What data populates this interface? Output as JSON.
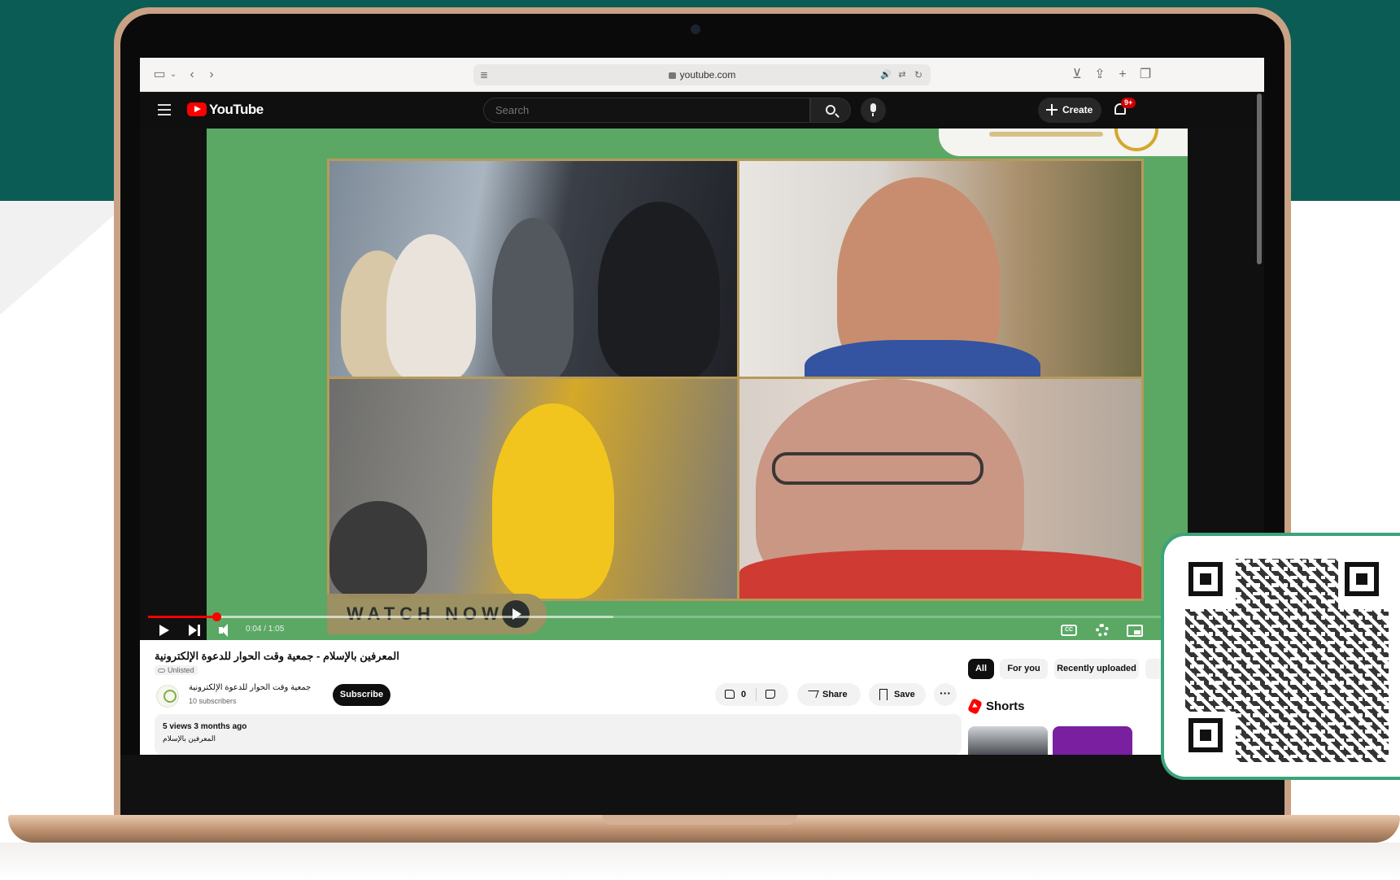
{
  "browser": {
    "url": "youtube.com"
  },
  "youtube": {
    "logo_text": "YouTube",
    "search_placeholder": "Search",
    "create_label": "Create",
    "notification_badge": "9+"
  },
  "video": {
    "overlay_text": "WATCH NOW",
    "time_display": "0:04 / 1:05",
    "progress_fraction": 0.0615,
    "buffered_fraction": 0.42,
    "cc_label": "CC"
  },
  "info": {
    "title": "المعرفين بالإسلام - جمعية وقت الحوار للدعوة الإلكترونية",
    "visibility": "Unlisted",
    "channel_name": "جمعية وقت الحوار للدعوة الإلكترونية",
    "subscribers": "10 subscribers",
    "subscribe_label": "Subscribe",
    "like_count": "0",
    "share_label": "Share",
    "save_label": "Save",
    "more_label": "···",
    "views_line": "5 views  3 months ago",
    "description_line": "المعرفين بالإسلام"
  },
  "sidebar": {
    "chips": [
      "All",
      "For you",
      "Recently uploaded"
    ],
    "shorts_label": "Shorts"
  },
  "colors": {
    "brand_teal": "#0b5c55",
    "youtube_red": "#ff0000",
    "video_green": "#5aa864",
    "qr_border": "#3aa47a"
  }
}
